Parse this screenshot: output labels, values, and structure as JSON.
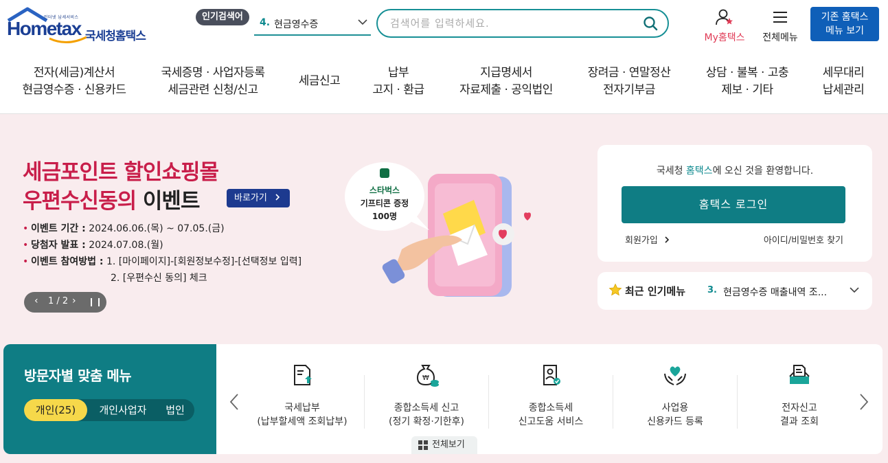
{
  "header": {
    "logo_small": "인터넷 납세서비스",
    "logo_word": "Hometax",
    "logo_kr": "국세청홈택스",
    "popular_badge": "인기검색어",
    "popular_num": "4.",
    "popular_text": "현금영수증",
    "search_placeholder": "검색어를 입력하세요.",
    "my_hometax": "My홈택스",
    "all_menu": "전체메뉴",
    "old_line1": "기존 홈택스",
    "old_line2": "메뉴 보기"
  },
  "nav": [
    {
      "l1": "전자(세금)계산서",
      "l2": "현금영수증 · 신용카드"
    },
    {
      "l1": "국세증명 · 사업자등록",
      "l2": "세금관련 신청/신고"
    },
    {
      "l1": "세금신고",
      "l2": ""
    },
    {
      "l1": "납부",
      "l2": "고지 · 환급"
    },
    {
      "l1": "지급명세서",
      "l2": "자료제출 · 공익법인"
    },
    {
      "l1": "장려금 · 연말정산",
      "l2": "전자기부금"
    },
    {
      "l1": "상담 · 불복 · 고충",
      "l2": "제보 · 기타"
    },
    {
      "l1": "세무대리",
      "l2": "납세관리"
    }
  ],
  "banner": {
    "title_line1": "세금포인트 할인쇼핑몰",
    "title_line2a": "우편수신동의",
    "title_line2b": " 이벤트",
    "go_button": "바로가기",
    "rows": [
      {
        "key": "이벤트 기간 :",
        "val": " 2024.06.06.(목) ~ 07.05.(금)"
      },
      {
        "key": "당첨자 발표 :",
        "val": " 2024.07.08.(월)"
      },
      {
        "key": "이벤트 참여방법 :",
        "val": " 1. [마이페이지]-[회원정보수정]-[선택정보 입력]"
      }
    ],
    "row_extra": "2. [우편수신 동의] 체크",
    "pager": "1 / 2",
    "bubble_l1": "스타벅스",
    "bubble_l2": "기프티콘 증정",
    "bubble_l3": "100명"
  },
  "login": {
    "welcome_a": "국세청 ",
    "welcome_hl": "홈택스",
    "welcome_b": "에 오신 것을 환영합니다.",
    "login_button": "홈택스 로그인",
    "join": "회원가입",
    "find": "아이디/비밀번호 찾기"
  },
  "recent": {
    "label": "최근 인기메뉴",
    "num": "3.",
    "text": "현금영수증 매출내역 조..."
  },
  "visitor": {
    "title": "방문자별 맞춤 메뉴",
    "tabs": [
      "개인(25)",
      "개인사업자",
      "법인"
    ]
  },
  "menu_items": [
    {
      "label": "국세납부\n(납부할세액 조회납부)",
      "icon": "tax-payment-icon"
    },
    {
      "label": "종합소득세 신고\n(정기 확정·기한후)",
      "icon": "money-bag-icon"
    },
    {
      "label": "종합소득세\n신고도움 서비스",
      "icon": "help-document-icon"
    },
    {
      "label": "사업용\n신용카드 등록",
      "icon": "heart-hands-icon"
    },
    {
      "label": "전자신고\n결과 조회",
      "icon": "document-tray-icon"
    }
  ],
  "view_all": "전체보기",
  "colors": {
    "teal": "#0f7d84",
    "brand_blue": "#1b3f94",
    "accent_red": "#c81e4a",
    "yellow": "#f6d84a"
  }
}
